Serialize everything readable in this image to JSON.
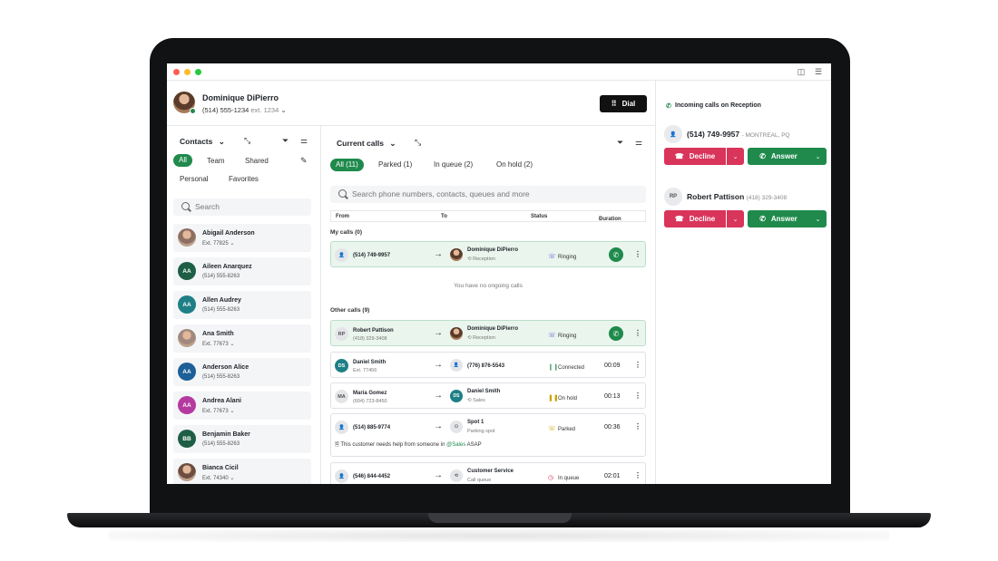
{
  "user": {
    "name": "Dominique DiPierro",
    "phone": "(514) 555-1234",
    "ext": "ext. 1234"
  },
  "header": {
    "dial_label": "Dial"
  },
  "contacts": {
    "title": "Contacts",
    "tabs": [
      "All",
      "Team",
      "Shared",
      "Personal",
      "Favorites"
    ],
    "search_placeholder": "Search",
    "items": [
      {
        "name": "Abigail Anderson",
        "sub": "Ext. 77825",
        "initials": "",
        "color": "#8d6e63"
      },
      {
        "name": "Aileen Anarquez",
        "sub": "(514) 555-8263",
        "initials": "AA",
        "color": "#1e5e45"
      },
      {
        "name": "Allen Audrey",
        "sub": "(514) 555-8263",
        "initials": "AA",
        "color": "#1e7f86"
      },
      {
        "name": "Ana Smith",
        "sub": "Ext. 77673",
        "initials": "",
        "color": "#a1887f"
      },
      {
        "name": "Anderson Alice",
        "sub": "(514) 555-8263",
        "initials": "AA",
        "color": "#1d5f97"
      },
      {
        "name": "Andrea Alani",
        "sub": "Ext. 77673",
        "initials": "AA",
        "color": "#b43aa0"
      },
      {
        "name": "Benjamin Baker",
        "sub": "(514) 555-8263",
        "initials": "BB",
        "color": "#1e5e45"
      },
      {
        "name": "Bianca Cicil",
        "sub": "Ext. 74340",
        "initials": "",
        "color": "#6d4c41"
      }
    ]
  },
  "calls": {
    "title": "Current calls",
    "filters": [
      "All (11)",
      "Parked (1)",
      "In queue (2)",
      "On hold (2)"
    ],
    "search_placeholder": "Search phone numbers, contacts, queues and more",
    "columns": {
      "from": "From",
      "to": "To",
      "status": "Status",
      "duration": "Duration"
    },
    "my_calls_label": "My calls (0)",
    "empty_text": "You have no ongoing calls",
    "other_calls_label": "Other calls (9)",
    "my_row": {
      "from": "(514) 749-9957",
      "to_name": "Dominique DiPierro",
      "to_sub": "Reception",
      "status": "Ringing"
    },
    "other_rows": [
      {
        "initials": "RP",
        "from": "Robert Pattison",
        "from_sub": "(418) 329-3408",
        "to_name": "Dominique DiPierro",
        "to_sub": "Reception",
        "status": "Ringing",
        "duration": ""
      },
      {
        "initials": "DS",
        "from": "Daniel Smith",
        "from_sub": "Ext. 77456",
        "to_name": "(776) 876-5543",
        "to_sub": "",
        "status": "Connected",
        "duration": "00:09"
      },
      {
        "initials": "MA",
        "from": "Maria Gomez",
        "from_sub": "(604) 723-8450",
        "to_name": "Daniel Smith",
        "to_sub": "Sales",
        "status": "On hold",
        "duration": "00:13"
      },
      {
        "initials": "",
        "from": "(514) 885-9774",
        "from_sub": "",
        "to_name": "Spot 1",
        "to_sub": "Parking spot",
        "status": "Parked",
        "duration": "00:36"
      },
      {
        "initials": "",
        "from": "(546) 844-4452",
        "from_sub": "",
        "to_name": "Customer Service",
        "to_sub": "Call queue",
        "status": "In queue",
        "duration": "02:01"
      }
    ],
    "note_prefix": "This customer needs help from someone in ",
    "note_mention": "@Sales",
    "note_suffix": " ASAP"
  },
  "incoming": {
    "title": "Incoming calls on Reception",
    "calls": [
      {
        "initials": "",
        "number": "(514) 749-9957",
        "location": "- MONTREAL, PQ"
      },
      {
        "initials": "RP",
        "number": "Robert Pattison",
        "location": "(418) 329-3408"
      }
    ],
    "decline_label": "Decline",
    "answer_label": "Answer"
  },
  "colors": {
    "accent": "#1f8a4c",
    "decline": "#d9345a"
  }
}
